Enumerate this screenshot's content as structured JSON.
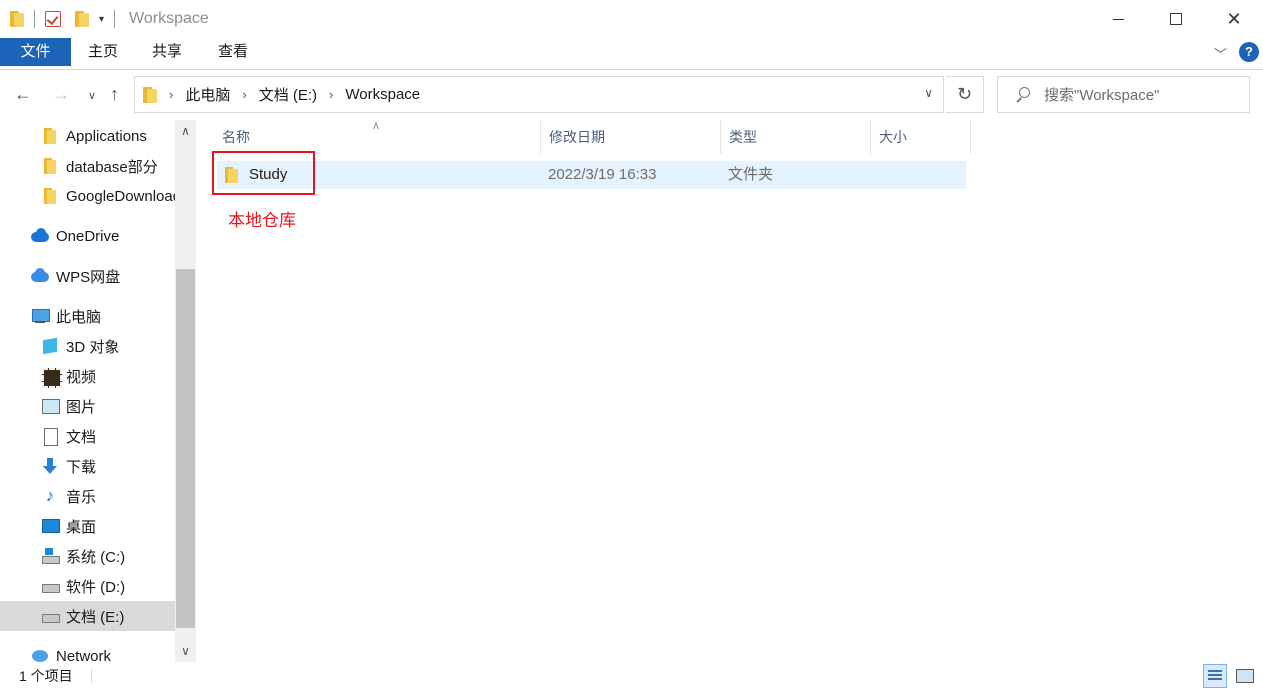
{
  "window": {
    "title": "Workspace"
  },
  "ribbon": {
    "tabs": [
      "文件",
      "主页",
      "共享",
      "查看"
    ],
    "help": "?"
  },
  "address": {
    "crumbs": [
      "此电脑",
      "文档 (E:)",
      "Workspace"
    ]
  },
  "search": {
    "placeholder": "搜索\"Workspace\""
  },
  "sidebar": {
    "items": [
      {
        "label": "Applications",
        "icon": "folder-icon"
      },
      {
        "label": "database部分",
        "icon": "folder-icon"
      },
      {
        "label": "GoogleDownload",
        "icon": "folder-icon"
      },
      {
        "label": "OneDrive",
        "icon": "onedrive-cloud-icon"
      },
      {
        "label": "WPS网盘",
        "icon": "wps-cloud-icon"
      },
      {
        "label": "此电脑",
        "icon": "this-pc-icon"
      },
      {
        "label": "3D 对象",
        "icon": "3d-objects-icon"
      },
      {
        "label": "视频",
        "icon": "videos-icon"
      },
      {
        "label": "图片",
        "icon": "pictures-icon"
      },
      {
        "label": "文档",
        "icon": "documents-icon"
      },
      {
        "label": "下载",
        "icon": "downloads-icon"
      },
      {
        "label": "音乐",
        "icon": "music-icon"
      },
      {
        "label": "桌面",
        "icon": "desktop-icon"
      },
      {
        "label": "系统 (C:)",
        "icon": "system-drive-icon"
      },
      {
        "label": "软件 (D:)",
        "icon": "drive-icon"
      },
      {
        "label": "文档 (E:)",
        "icon": "drive-icon",
        "selected": true
      },
      {
        "label": "Network",
        "icon": "network-icon"
      }
    ]
  },
  "columns": {
    "name": "名称",
    "date": "修改日期",
    "type": "类型",
    "size": "大小"
  },
  "files": [
    {
      "name": "Study",
      "date": "2022/3/19 16:33",
      "type": "文件夹",
      "size": ""
    }
  ],
  "annotation": {
    "text": "本地仓库",
    "color": "#e8141c"
  },
  "status": {
    "count": "1 个项目"
  },
  "colors": {
    "accent": "#1c64b8",
    "selection": "#e5f3ff"
  }
}
